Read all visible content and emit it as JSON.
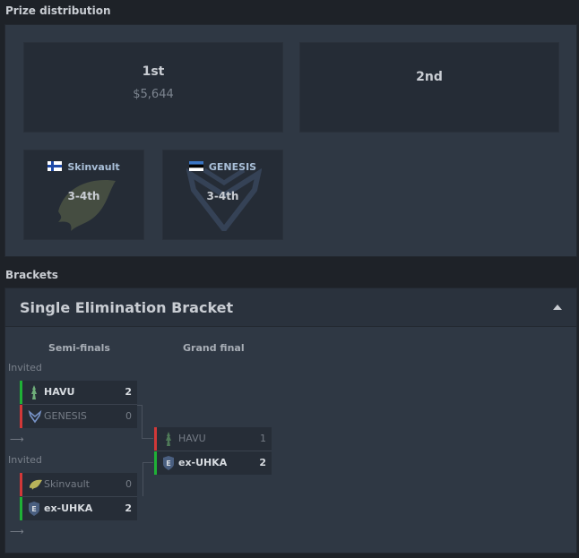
{
  "prize_distribution": {
    "title": "Prize distribution",
    "first": {
      "place": "1st",
      "amount": "$5,644"
    },
    "second": {
      "place": "2nd"
    },
    "teams": [
      {
        "name": "Skinvault",
        "place": "3-4th",
        "flag": "finland"
      },
      {
        "name": "GENESIS",
        "place": "3-4th",
        "flag": "estonia"
      }
    ]
  },
  "brackets": {
    "title": "Brackets",
    "panel_title": "Single Elimination Bracket",
    "rounds": [
      "Semi-finals",
      "Grand final"
    ],
    "invited_label": "Invited",
    "arrow_glyph": "⟶",
    "semi1": {
      "a": {
        "name": "HAVU",
        "score": "2"
      },
      "b": {
        "name": "GENESIS",
        "score": "0"
      }
    },
    "semi2": {
      "a": {
        "name": "Skinvault",
        "score": "0"
      },
      "b": {
        "name": "ex-UHKA",
        "score": "2"
      }
    },
    "final": {
      "a": {
        "name": "HAVU",
        "score": "1"
      },
      "b": {
        "name": "ex-UHKA",
        "score": "2"
      }
    }
  },
  "colors": {
    "win": "#1fb036",
    "lose": "#d13838",
    "panel": "#2f3844",
    "background": "#1e2228"
  }
}
